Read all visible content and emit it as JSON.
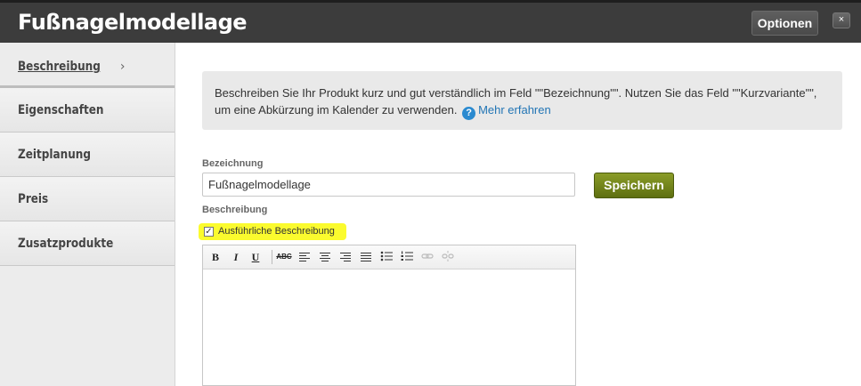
{
  "header": {
    "title": "Fußnagelmodellage",
    "options_label": "Optionen",
    "close_label": "×"
  },
  "sidebar": {
    "items": [
      {
        "label": "Beschreibung",
        "active": true
      },
      {
        "label": "Eigenschaften"
      },
      {
        "label": "Zeitplanung"
      },
      {
        "label": "Preis"
      },
      {
        "label": "Zusatzprodukte"
      }
    ],
    "active_chevron": "›"
  },
  "info": {
    "text_line1": "Beschreiben Sie Ihr Produkt kurz und gut verständlich im Feld \"\"Bezeichnung\"\". Nutzen Sie das Feld \"\"Kurzvariante\"\",",
    "text_line2": "um eine Abkürzung im Kalender zu verwenden.",
    "help_icon": "?",
    "link_label": "Mehr erfahren"
  },
  "form": {
    "name_label": "Bezeichnung",
    "name_value": "Fußnagelmodellage",
    "save_label": "Speichern",
    "description_label": "Beschreibung",
    "detailed_checkbox_label": "Ausführliche Beschreibung",
    "detailed_checked": true,
    "checkmark": "✓"
  },
  "toolbar": {
    "bold": "B",
    "italic": "I",
    "underline": "U",
    "strikethrough": "ABC"
  },
  "colors": {
    "accent_green": "#6f8019",
    "link_blue": "#2275b5",
    "highlight_yellow": "#fbfb2e",
    "topbar": "#3c3c3c"
  }
}
